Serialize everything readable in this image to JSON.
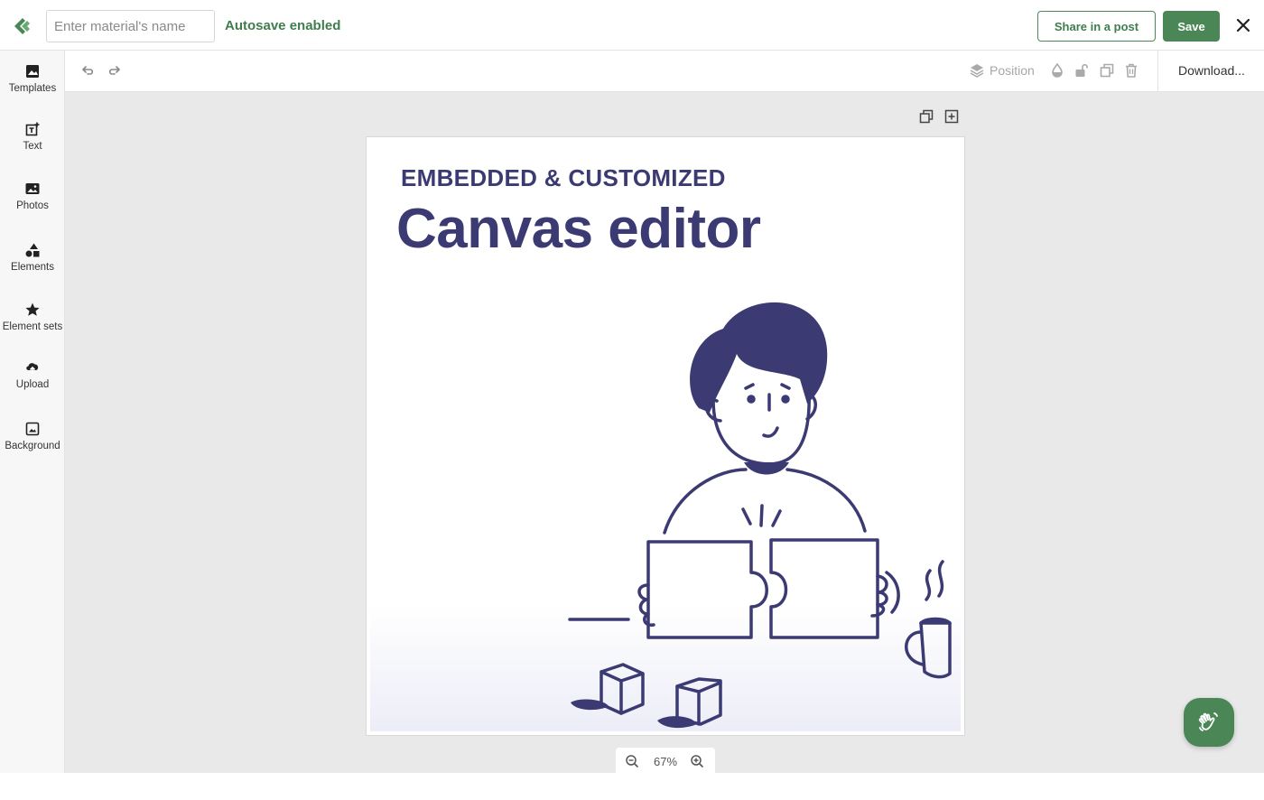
{
  "header": {
    "name_placeholder": "Enter material's name",
    "name_value": "",
    "autosave_label": "Autosave enabled",
    "share_label": "Share in a post",
    "save_label": "Save"
  },
  "sidebar": {
    "items": [
      {
        "label": "Templates",
        "icon": "image-icon"
      },
      {
        "label": "Text",
        "icon": "text-add-icon"
      },
      {
        "label": "Photos",
        "icon": "photo-icon"
      },
      {
        "label": "Elements",
        "icon": "shapes-icon"
      },
      {
        "label": "Element sets",
        "icon": "star-icon"
      },
      {
        "label": "Upload",
        "icon": "cloud-upload-icon"
      },
      {
        "label": "Background",
        "icon": "background-icon"
      }
    ]
  },
  "toolbar": {
    "position_label": "Position",
    "download_label": "Download..."
  },
  "canvas": {
    "kicker": "EMBEDDED & CUSTOMIZED",
    "headline": "Canvas editor"
  },
  "zoom": {
    "value": "67%"
  },
  "colors": {
    "brand_green": "#4b8657",
    "ink": "#3b3a72"
  }
}
